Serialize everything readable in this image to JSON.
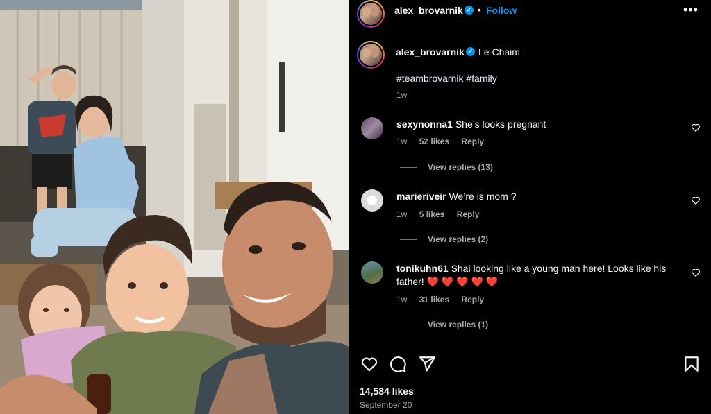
{
  "post": {
    "username": "alex_brovarnik",
    "follow_label": "Follow",
    "dot": "•",
    "more": "•••",
    "caption": "Le Chaim .",
    "hashtags": "#teambrovarnik #family",
    "time": "1w",
    "likes": "14,584 likes",
    "date": "September 20",
    "accent_color": "#0095f6"
  },
  "comments": [
    {
      "username": "sexynonna1",
      "text": "She’s looks pregnant",
      "time": "1w",
      "likes": "52 likes",
      "reply": "Reply",
      "view_replies": "View replies (13)"
    },
    {
      "username": "marieriveir",
      "text": "We’re is mom ?",
      "time": "1w",
      "likes": "5 likes",
      "reply": "Reply",
      "view_replies": "View replies (2)"
    },
    {
      "username": "tonikuhn61",
      "text": "Shai looking like a young man here! Looks like his father! ❤️ ❤️ ❤️ ❤️ ❤️",
      "time": "1w",
      "likes": "31 likes",
      "reply": "Reply",
      "view_replies": "View replies (1)"
    }
  ],
  "icons": {
    "like": "heart-icon",
    "comment": "comment-icon",
    "share": "share-icon",
    "save": "bookmark-icon"
  }
}
